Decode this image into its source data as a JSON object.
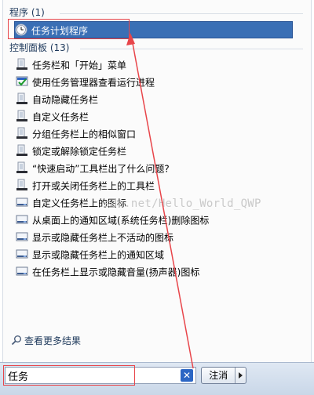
{
  "programs": {
    "header": "程序 (1)",
    "items": [
      {
        "label": "任务计划程序",
        "icon": "clock-icon"
      }
    ]
  },
  "control_panel": {
    "header": "控制面板 (13)",
    "items": [
      {
        "label": "任务栏和「开始」菜单",
        "icon": "taskbar-icon"
      },
      {
        "label": "使用任务管理器查看运行进程",
        "icon": "task-manager-icon"
      },
      {
        "label": "自动隐藏任务栏",
        "icon": "taskbar-icon"
      },
      {
        "label": "自定义任务栏",
        "icon": "taskbar-icon"
      },
      {
        "label": "分组任务栏上的相似窗口",
        "icon": "taskbar-icon"
      },
      {
        "label": "锁定或解除锁定任务栏",
        "icon": "taskbar-icon"
      },
      {
        "label": "“快速启动”工具栏出了什么问题?",
        "icon": "taskbar-icon"
      },
      {
        "label": "打开或关闭任务栏上的工具栏",
        "icon": "taskbar-icon"
      },
      {
        "label": "自定义任务栏上的图标",
        "icon": "notification-area-icon"
      },
      {
        "label": "从桌面上的通知区域(系统任务栏)删除图标",
        "icon": "notification-area-icon"
      },
      {
        "label": "显示或隐藏任务栏上不活动的图标",
        "icon": "notification-area-icon"
      },
      {
        "label": "显示或隐藏任务栏上的通知区域",
        "icon": "notification-area-icon"
      },
      {
        "label": "在任务栏上显示或隐藏音量(扬声器)图标",
        "icon": "notification-area-icon"
      }
    ]
  },
  "see_more": "查看更多结果",
  "search": {
    "value": "任务"
  },
  "cancel_label": "注消",
  "watermark": "sdn.net/Hello_World_QWP",
  "colors": {
    "selection": "#3a6fb5",
    "annotation": "#e8454a",
    "header_text": "#1e395b"
  }
}
